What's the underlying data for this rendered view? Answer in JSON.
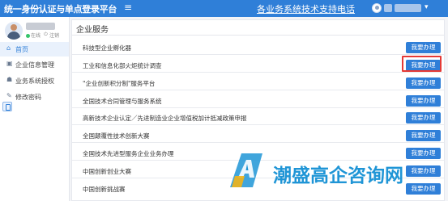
{
  "header": {
    "title": "统一身份认证与单点登录平台",
    "support_link": "各业务系统技术支持电话"
  },
  "sidebar": {
    "status_online": "在线",
    "logout": "注销",
    "items": [
      {
        "label": "首页",
        "icon": "home-icon"
      },
      {
        "label": "企业信息管理",
        "icon": "building-icon"
      },
      {
        "label": "业务系统授权",
        "icon": "users-icon"
      },
      {
        "label": "修改密码",
        "icon": "pencil-icon"
      }
    ]
  },
  "main": {
    "title": "企业服务",
    "button_label": "我要办理",
    "services": [
      "科技型企业孵化器",
      "工业和信息化部火炬统计调查",
      "\"企业创新积分制\"服务平台",
      "全国技术合同管理与服务系统",
      "高新技术企业认定／先进制造业企业增值税加计抵减政策申报",
      "全国颠覆性技术创新大赛",
      "全国技术先进型服务企业业务办理",
      "中国创新创业大赛",
      "中国创新挑战赛"
    ]
  },
  "watermark": {
    "text": "潮盛高企咨询网",
    "colors": {
      "primary": "#1f95d6",
      "accent": "#f2b417"
    }
  },
  "colors": {
    "brand": "#2f7fd8",
    "highlight": "#e53935"
  }
}
